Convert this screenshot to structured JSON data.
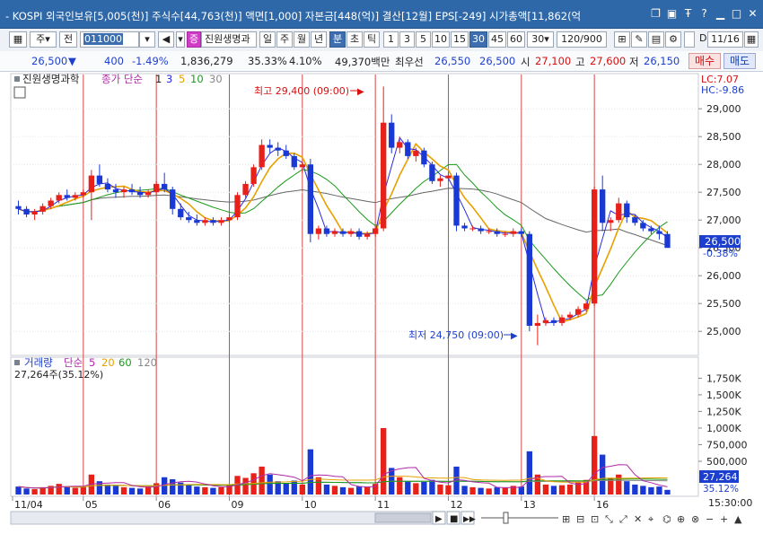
{
  "window": {
    "title": "- KOSPI  외국인보유[5,005(천)]  주식수[44,763(천)]  액면[1,000]  자본금[448(억)]  결산[12월]  EPS[-249]  시가총액[11,862(억"
  },
  "toolbar": {
    "type_label": "주",
    "prefix_label": "전",
    "code_value": "011000",
    "stock_name": "진원생명과",
    "periods": [
      "일",
      "주",
      "월",
      "년",
      "분",
      "초",
      "틱"
    ],
    "selected_period": "분",
    "intervals": [
      "1",
      "3",
      "5",
      "10",
      "15",
      "30",
      "45",
      "60"
    ],
    "selected_interval": "30",
    "interval_select": "30",
    "count_value": "120",
    "count_total": "/900",
    "date_value": "11/16"
  },
  "quote": {
    "price": "26,500",
    "arrow": "▼",
    "change": "400",
    "change_pct": "-1.49%",
    "volume": "1,836,279",
    "vol_ratio": "35.33%",
    "turnover": "4.10%",
    "amount": "49,370백만",
    "best_label": "최우선",
    "ask": "26,550",
    "bid": "26,500",
    "open_label": "시",
    "open": "27,100",
    "high_label": "고",
    "high": "27,600",
    "low_label": "저",
    "low": "26,150",
    "buy_label": "매수",
    "sell_label": "매도"
  },
  "chart": {
    "price_legend_name": "진원생명과학",
    "price_legend_ma": "종가 단순",
    "ma_periods": [
      "1",
      "3",
      "5",
      "10",
      "30"
    ],
    "lc_label": "LC:7.07",
    "hc_label": "HC:-9.86",
    "high_annotation": "최고 29,400 (09:00)",
    "low_annotation": "최저 24,750 (09:00)",
    "current_price_label": "26,500",
    "current_pct_label": "-0.38%",
    "price_ticks": [
      "29,000",
      "28,500",
      "28,000",
      "27,500",
      "27,000",
      "26,500",
      "26,000",
      "25,500",
      "25,000"
    ],
    "volume_legend": "거래량",
    "volume_ma_label": "단순",
    "volume_ma_periods": [
      "5",
      "20",
      "60",
      "120"
    ],
    "volume_current": "27,264주(35.12%)",
    "volume_ticks": [
      "1,750K",
      "1,500K",
      "1,250K",
      "1,000K",
      "750,000",
      "500,000"
    ],
    "volume_now_label": "27,264",
    "volume_pct_label": "35.12%",
    "date_labels": [
      "11/04",
      "05",
      "06",
      "09",
      "10",
      "11",
      "12",
      "13",
      "16"
    ],
    "time_label": "15:30:00",
    "colors": {
      "up": "#e8201a",
      "down": "#1a39d4",
      "ma1": "#222222",
      "ma3": "#2a2ae0",
      "ma5": "#e8a000",
      "ma10": "#1a9a1a",
      "ma30": "#666666"
    }
  },
  "chart_data": {
    "type": "candlestick",
    "title": "진원생명과학",
    "interval": "30분",
    "ylim": [
      24600,
      29600
    ],
    "session_starts": [
      "11/04",
      "05",
      "06",
      "09",
      "10",
      "11",
      "12",
      "13",
      "16"
    ],
    "annotations": [
      {
        "text": "최고 29,400 (09:00)",
        "value": 29400
      },
      {
        "text": "최저 24,750 (09:00)",
        "value": 24750
      }
    ],
    "candles": [
      [
        27250,
        27350,
        27100,
        27200,
        120
      ],
      [
        27200,
        27250,
        27050,
        27100,
        90
      ],
      [
        27100,
        27200,
        27000,
        27150,
        80
      ],
      [
        27150,
        27300,
        27100,
        27250,
        110
      ],
      [
        27250,
        27400,
        27200,
        27350,
        130
      ],
      [
        27350,
        27500,
        27300,
        27450,
        160
      ],
      [
        27450,
        27550,
        27350,
        27400,
        120
      ],
      [
        27400,
        27500,
        27350,
        27450,
        100
      ],
      [
        27450,
        27550,
        27400,
        27500,
        110
      ],
      [
        27500,
        27900,
        27000,
        27800,
        300
      ],
      [
        27800,
        28000,
        27600,
        27650,
        200
      ],
      [
        27650,
        27750,
        27500,
        27550,
        150
      ],
      [
        27550,
        27650,
        27400,
        27500,
        130
      ],
      [
        27500,
        27600,
        27400,
        27550,
        110
      ],
      [
        27550,
        27650,
        27450,
        27500,
        100
      ],
      [
        27500,
        27600,
        27400,
        27450,
        90
      ],
      [
        27450,
        27550,
        27400,
        27500,
        120
      ],
      [
        27500,
        27700,
        27450,
        27650,
        170
      ],
      [
        27650,
        27850,
        27500,
        27550,
        260
      ],
      [
        27550,
        27600,
        27100,
        27200,
        230
      ],
      [
        27200,
        27300,
        27000,
        27050,
        180
      ],
      [
        27050,
        27150,
        26950,
        27000,
        150
      ],
      [
        27000,
        27100,
        26900,
        26950,
        120
      ],
      [
        26950,
        27050,
        26900,
        27000,
        110
      ],
      [
        27000,
        27050,
        26900,
        26950,
        100
      ],
      [
        26950,
        27050,
        26900,
        27000,
        110
      ],
      [
        27000,
        27100,
        26950,
        27050,
        140
      ],
      [
        27050,
        27500,
        27000,
        27450,
        280
      ],
      [
        27450,
        27700,
        27400,
        27650,
        250
      ],
      [
        27650,
        28000,
        27600,
        27950,
        320
      ],
      [
        27950,
        28450,
        27900,
        28350,
        420
      ],
      [
        28350,
        28450,
        28200,
        28300,
        300
      ],
      [
        28300,
        28400,
        28150,
        28250,
        200
      ],
      [
        28250,
        28350,
        28100,
        28150,
        170
      ],
      [
        28150,
        28200,
        27900,
        27950,
        210
      ],
      [
        27950,
        28050,
        27850,
        28000,
        150
      ],
      [
        28000,
        28100,
        26600,
        26750,
        680
      ],
      [
        26750,
        26900,
        26650,
        26850,
        260
      ],
      [
        26850,
        26900,
        26700,
        26750,
        150
      ],
      [
        26750,
        26850,
        26700,
        26800,
        130
      ],
      [
        26800,
        26850,
        26700,
        26750,
        110
      ],
      [
        26750,
        26850,
        26700,
        26800,
        100
      ],
      [
        26800,
        26850,
        26650,
        26700,
        120
      ],
      [
        26700,
        26800,
        26650,
        26750,
        110
      ],
      [
        26750,
        26900,
        26700,
        26850,
        160
      ],
      [
        26850,
        29400,
        26800,
        28750,
        1000
      ],
      [
        28750,
        28900,
        28200,
        28300,
        400
      ],
      [
        28300,
        28500,
        28200,
        28400,
        260
      ],
      [
        28400,
        28450,
        28100,
        28150,
        200
      ],
      [
        28150,
        28300,
        28050,
        28250,
        170
      ],
      [
        28250,
        28300,
        27950,
        28000,
        190
      ],
      [
        28000,
        28050,
        27650,
        27700,
        220
      ],
      [
        27700,
        27800,
        27600,
        27750,
        150
      ],
      [
        27750,
        27850,
        27700,
        27800,
        140
      ],
      [
        27800,
        27850,
        26800,
        26900,
        420
      ],
      [
        26900,
        26950,
        26800,
        26850,
        130
      ],
      [
        26850,
        26900,
        26800,
        26850,
        110
      ],
      [
        26850,
        26900,
        26750,
        26800,
        100
      ],
      [
        26800,
        26850,
        26750,
        26800,
        90
      ],
      [
        26800,
        26850,
        26700,
        26750,
        110
      ],
      [
        26750,
        26800,
        26700,
        26750,
        100
      ],
      [
        26750,
        26850,
        26700,
        26800,
        130
      ],
      [
        26800,
        26850,
        26700,
        26750,
        120
      ],
      [
        26750,
        26800,
        25000,
        25100,
        650
      ],
      [
        25100,
        25300,
        24750,
        25150,
        300
      ],
      [
        25150,
        25250,
        25100,
        25200,
        150
      ],
      [
        25200,
        25250,
        25100,
        25150,
        130
      ],
      [
        25150,
        25300,
        25100,
        25250,
        140
      ],
      [
        25250,
        25350,
        25200,
        25300,
        150
      ],
      [
        25300,
        25450,
        25250,
        25400,
        180
      ],
      [
        25400,
        25550,
        25350,
        25500,
        220
      ],
      [
        25500,
        27600,
        25450,
        27550,
        880
      ],
      [
        27550,
        27800,
        26800,
        26950,
        600
      ],
      [
        26950,
        27050,
        26800,
        27000,
        250
      ],
      [
        27000,
        27400,
        26950,
        27300,
        300
      ],
      [
        27300,
        27350,
        26950,
        27050,
        200
      ],
      [
        27050,
        27100,
        26900,
        26950,
        150
      ],
      [
        26950,
        27000,
        26800,
        26850,
        130
      ],
      [
        26850,
        26900,
        26750,
        26800,
        110
      ],
      [
        26800,
        26900,
        26650,
        26750,
        120
      ],
      [
        26750,
        26800,
        26600,
        26500,
        70
      ]
    ]
  }
}
